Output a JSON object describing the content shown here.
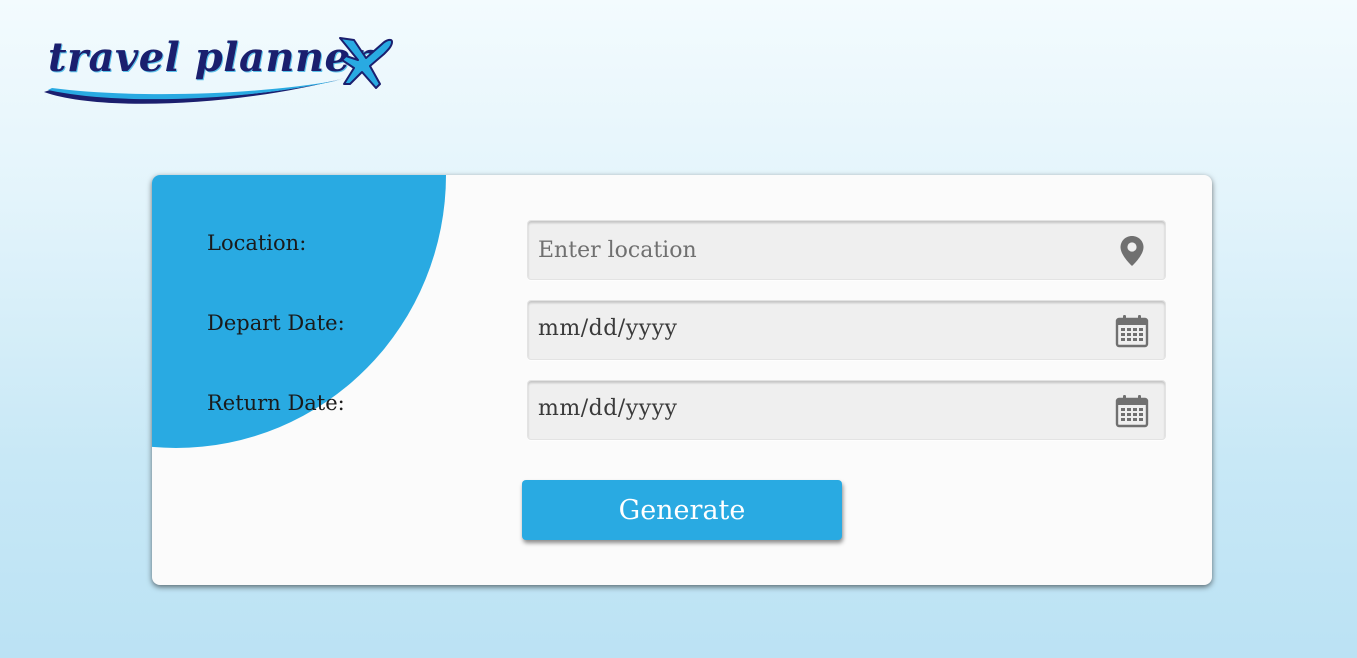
{
  "brand": {
    "logo_text": "travel planner",
    "logo_icon": "airplane-icon"
  },
  "form": {
    "location": {
      "label": "Location:",
      "placeholder": "Enter location",
      "value": "",
      "icon": "map-pin-icon"
    },
    "depart_date": {
      "label": "Depart Date:",
      "value": "mm/dd/yyyy",
      "icon": "calendar-icon"
    },
    "return_date": {
      "label": "Return Date:",
      "value": "mm/dd/yyyy",
      "icon": "calendar-icon"
    },
    "submit_label": "Generate"
  },
  "colors": {
    "accent": "#29aae2",
    "brand_text": "#1b1f6e",
    "field_bg": "#efefef"
  }
}
